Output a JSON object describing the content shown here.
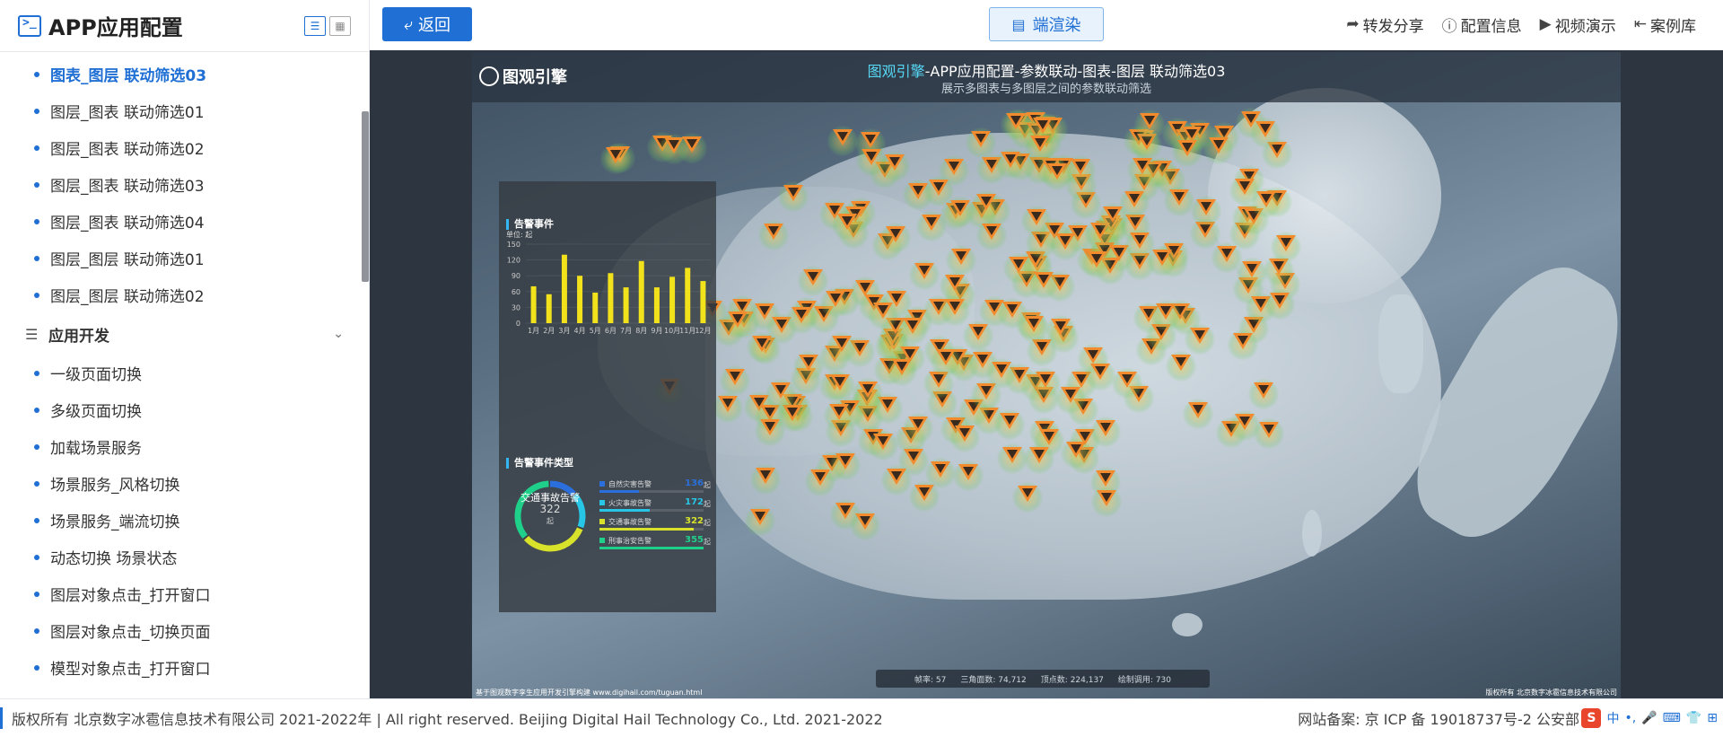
{
  "sidebar": {
    "title": "APP应用配置",
    "items_top": [
      {
        "label": "图表_图层 联动筛选03",
        "active": true
      },
      {
        "label": "图层_图表 联动筛选01"
      },
      {
        "label": "图层_图表 联动筛选02"
      },
      {
        "label": "图层_图表 联动筛选03"
      },
      {
        "label": "图层_图表 联动筛选04"
      },
      {
        "label": "图层_图层 联动筛选01"
      },
      {
        "label": "图层_图层 联动筛选02"
      }
    ],
    "group": {
      "label": "应用开发"
    },
    "items_group": [
      {
        "label": "一级页面切换"
      },
      {
        "label": "多级页面切换"
      },
      {
        "label": "加载场景服务"
      },
      {
        "label": "场景服务_风格切换"
      },
      {
        "label": "场景服务_端流切换"
      },
      {
        "label": "动态切换 场景状态"
      },
      {
        "label": "图层对象点击_打开窗口"
      },
      {
        "label": "图层对象点击_切换页面"
      },
      {
        "label": "模型对象点击_打开窗口"
      }
    ]
  },
  "toolbar": {
    "back_label": "返回",
    "render_label": "端渲染",
    "actions": [
      {
        "icon": "share-icon",
        "label": "转发分享"
      },
      {
        "icon": "info-icon",
        "label": "配置信息"
      },
      {
        "icon": "play-icon",
        "label": "视频演示"
      },
      {
        "icon": "library-icon",
        "label": "案例库"
      }
    ]
  },
  "scene": {
    "brand": "图观引擎",
    "title_highlight": "图观引擎",
    "title_rest": "-APP应用配置-参数联动-图表-图层 联动筛选03",
    "subtitle": "展示多图表与多图层之间的参数联动筛选",
    "stats": {
      "fps_label": "帧率:",
      "fps": "57",
      "tri_label": "三角面数:",
      "tri": "74,712",
      "vert_label": "顶点数:",
      "vert": "224,137",
      "draw_label": "绘制调用:",
      "draw": "730"
    },
    "foot_left": "基于图观数字孪生应用开发引擎构建 www.digihail.com/tuguan.html",
    "foot_right": "版权所有 北京数字冰雹信息技术有限公司"
  },
  "panel": {
    "bar_title": "告警事件",
    "bar_unit": "单位: 起",
    "donut_title": "告警事件类型",
    "donut_center_label": "交通事故告警",
    "donut_center_value": "322",
    "donut_center_unit": "起",
    "legend": [
      {
        "name": "自然灾害告警",
        "value": "136",
        "unit": "起",
        "color": "#2a6fdb"
      },
      {
        "name": "火灾事故告警",
        "value": "172",
        "unit": "起",
        "color": "#28c6e6"
      },
      {
        "name": "交通事故告警",
        "value": "322",
        "unit": "起",
        "color": "#d8e22a"
      },
      {
        "name": "刑事治安告警",
        "value": "355",
        "unit": "起",
        "color": "#1fd08a"
      }
    ]
  },
  "chart_data": {
    "type": "bar",
    "title": "告警事件",
    "ylabel": "单位: 起",
    "categories": [
      "1月",
      "2月",
      "3月",
      "4月",
      "5月",
      "6月",
      "7月",
      "8月",
      "9月",
      "10月",
      "11月",
      "12月"
    ],
    "values": [
      70,
      55,
      130,
      90,
      58,
      95,
      68,
      118,
      68,
      88,
      105,
      80
    ],
    "ylim": [
      0,
      150
    ],
    "yticks": [
      0,
      30,
      60,
      90,
      120,
      150
    ],
    "color": "#f2e21c"
  },
  "footer": {
    "copyright": "版权所有 北京数字冰雹信息技术有限公司 2021-2022年 | All right reserved. Beijing Digital Hail Technology Co., Ltd. 2021-2022",
    "icp": "网站备案: 京 ICP 备 19018737号-2 公安部",
    "ime_label": "中"
  }
}
